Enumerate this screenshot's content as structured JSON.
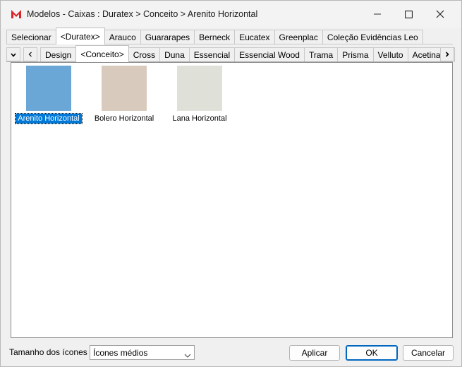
{
  "window": {
    "title": "Modelos - Caixas :  Duratex > Conceito > Arenito Horizontal",
    "app_icon": "m-logo-icon",
    "controls": [
      "minimize-icon",
      "maximize-icon",
      "close-icon"
    ]
  },
  "brand_tabs": {
    "items": [
      "Selecionar",
      "<Duratex>",
      "Arauco",
      "Guararapes",
      "Berneck",
      "Eucatex",
      "Greenplac",
      "Coleção Evidências Leo"
    ],
    "active": "<Duratex>"
  },
  "line_tabs": {
    "items": [
      "Design",
      "<Conceito>",
      "Cross",
      "Duna",
      "Essencial",
      "Essencial Wood",
      "Trama",
      "Prisma",
      "Velluto",
      "Acetinatta"
    ],
    "active": "<Conceito>",
    "scroll_icons": [
      "chevron-down-icon",
      "chevron-left-icon",
      "chevron-right-icon"
    ]
  },
  "materials": [
    {
      "label": "Arenito Horizontal",
      "color": "#6aa6d6",
      "selected": true
    },
    {
      "label": "Bolero Horizontal",
      "color": "#d8cbbd",
      "selected": false
    },
    {
      "label": "Lana Horizontal",
      "color": "#dfe0d8",
      "selected": false
    }
  ],
  "footer": {
    "size_label": "Tamanho dos ícones",
    "size_value": "Ícones médios",
    "apply_label": "Aplicar",
    "ok_label": "OK",
    "cancel_label": "Cancelar"
  },
  "colors": {
    "selection": "#0078d7",
    "icon_red": "#d6262b",
    "default_button_border": "#0067c0"
  }
}
